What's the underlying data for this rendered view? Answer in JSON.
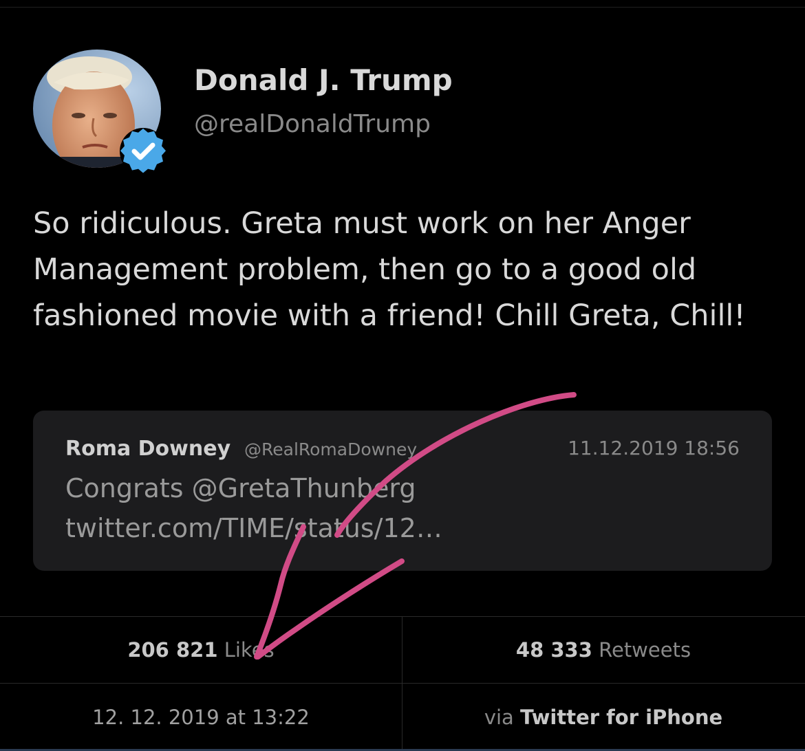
{
  "tweet": {
    "author": {
      "name": "Donald J. Trump",
      "handle": "@realDonaldTrump",
      "verified": true,
      "avatar_icon": "profile-photo",
      "verified_icon": "verified-badge-icon"
    },
    "text": "So ridiculous. Greta must work on her Anger Management problem, then go to a good old fashioned movie with a friend! Chill Greta, Chill!",
    "quoted": {
      "name": "Roma Downey",
      "handle": "@RealRomaDowney",
      "date": "11.12.2019 18:56",
      "text": "Congrats @GretaThunberg twitter.com/TIME/status/12…"
    },
    "stats": {
      "likes_count": "206 821",
      "likes_label": "Likes",
      "retweets_count": "48 333",
      "retweets_label": "Retweets",
      "timestamp": "12. 12. 2019 at 13:22",
      "via_prefix": "via",
      "source": "Twitter for iPhone"
    }
  },
  "annotation": {
    "type": "hand-drawn arrow",
    "color": "#d14b86"
  },
  "colors": {
    "background": "#000000",
    "card": "#1c1c1e",
    "verified": "#4aa8e8"
  }
}
